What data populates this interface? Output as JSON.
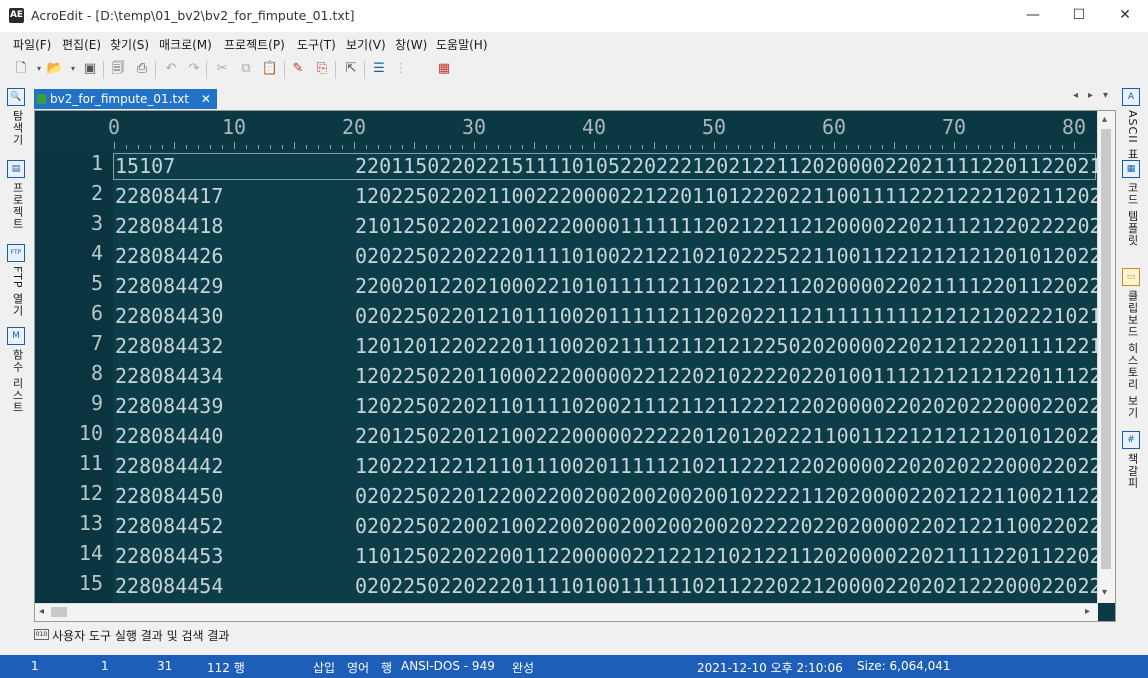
{
  "window": {
    "title": "AcroEdit - [D:\\temp\\01_bv2\\bv2_for_fimpute_01.txt]",
    "app_icon": "AE",
    "minimize": "—",
    "maximize": "☐",
    "close": "✕"
  },
  "menu": [
    "파일(F)",
    "편집(E)",
    "찾기(S)",
    "매크로(M)",
    "프로젝트(P)",
    "도구(T)",
    "보기(V)",
    "창(W)",
    "도움말(H)"
  ],
  "toolbar_icons": [
    "new-file-icon",
    "open-folder-icon",
    "save-icon",
    "print-preview-icon",
    "print-icon",
    "undo-icon",
    "redo-icon",
    "cut-icon",
    "copy-icon",
    "paste-icon",
    "marker-icon",
    "bookmark-icon",
    "export-icon",
    "list-icon",
    "grid-icon"
  ],
  "left_panel": {
    "tabs": [
      "탐색기",
      "프로젝트",
      "FTP 열기",
      "함수 리스트"
    ]
  },
  "right_panel": {
    "tabs": [
      "ASCII 표",
      "코드 템플릿",
      "클립보드 히스토리 보기",
      "책갈피"
    ]
  },
  "doc_tab": {
    "label": "bv2_for_fimpute_01.txt",
    "close": "✕"
  },
  "ruler": [
    "0",
    "10",
    "20",
    "30",
    "40",
    "50",
    "60",
    "70",
    "80"
  ],
  "lines": [
    {
      "num": "1",
      "id": "15107",
      "geno": "22011502202215111101052202221202122112020000220211112201122021"
    },
    {
      "num": "2",
      "id": "228084417",
      "geno": "12022502202110022200002212201101222022110011112221222120211202"
    },
    {
      "num": "3",
      "id": "228084418",
      "geno": "21012502202210022200001111111202122112120000220211121220222202"
    },
    {
      "num": "4",
      "id": "228084426",
      "geno": "02022502202220111101002212210210222522110011221212121201012022"
    },
    {
      "num": "5",
      "id": "228084429",
      "geno": "22002012202100022101011111211202122112020000220211112201122022"
    },
    {
      "num": "6",
      "id": "228084430",
      "geno": "02022502201210111002011111211202022112111111111212121202221021"
    },
    {
      "num": "7",
      "id": "228084432",
      "geno": "12012012202220111002021111211212122502020000220212122201111221"
    },
    {
      "num": "8",
      "id": "228084434",
      "geno": "12022502201100022200000221220210222202201001112121212122011122"
    },
    {
      "num": "9",
      "id": "228084439",
      "geno": "12022502202110111102002111211211222122020000220202022200022022"
    },
    {
      "num": "10",
      "id": "228084440",
      "geno": "22012502201210022200000222220120120222110011221212121201012022"
    },
    {
      "num": "11",
      "id": "228084442",
      "geno": "12022212212110111002011111210211222122020000220202022200022022"
    },
    {
      "num": "12",
      "id": "228084450",
      "geno": "02022502201220022002002002002001022221120200002202122110021122"
    },
    {
      "num": "13",
      "id": "228084452",
      "geno": "02022502200210022002002002002002022220220200002202122110022022"
    },
    {
      "num": "14",
      "id": "228084453",
      "geno": "11012502202200112200000221221210212211202000022021111220112202"
    },
    {
      "num": "15",
      "id": "228084454",
      "geno": "02022502202220111101001111110211222022120000220202122200022022"
    }
  ],
  "output_panel": {
    "label": "사용자 도구 실행 결과 및 검색 결과"
  },
  "status": {
    "line": "1",
    "col": "1",
    "chars": "31",
    "total_lines": "112 행",
    "mode_insert": "삽입",
    "lang": "영어",
    "row": "행",
    "encoding": "ANSI-DOS - 949",
    "state": "완성",
    "datetime": "2021-12-10 오후 2:10:06",
    "size": "Size: 6,064,041"
  },
  "colors": {
    "editor_bg": "#0c3d49",
    "status_bg": "#1d5fb8",
    "tab_bg": "#2273c8"
  }
}
